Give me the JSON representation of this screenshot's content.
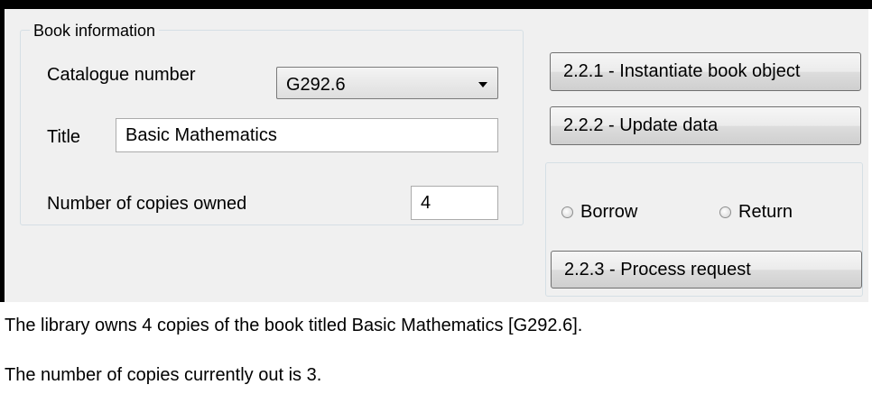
{
  "book_info": {
    "group_title": "Book information",
    "catalogue_label": "Catalogue number",
    "catalogue_value": "G292.6",
    "title_label": "Title",
    "title_value": "Basic Mathematics",
    "copies_label": "Number of copies owned",
    "copies_value": "4"
  },
  "buttons": {
    "instantiate": "2.2.1 - Instantiate book object",
    "update": "2.2.2 - Update data",
    "process": "2.2.3 - Process request"
  },
  "request": {
    "borrow_label": "Borrow",
    "return_label": "Return"
  },
  "output": {
    "line1": "The library owns 4 copies of the book titled Basic Mathematics [G292.6].",
    "line2": "The number of copies currently out is 3."
  },
  "colors": {
    "window_frame": "#000000",
    "panel_background": "#f0f0f0",
    "group_border": "#d5dfe5"
  }
}
